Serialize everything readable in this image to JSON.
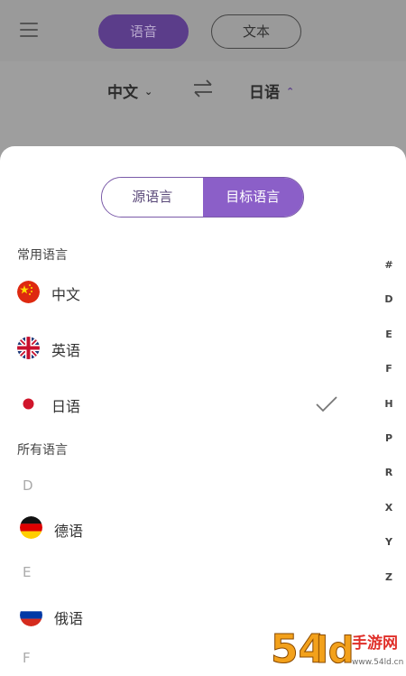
{
  "header": {
    "mode_voice": "语音",
    "mode_text": "文本"
  },
  "langbar": {
    "source": "中文",
    "target": "日语"
  },
  "sheet": {
    "tab_source": "源语言",
    "tab_target": "目标语言",
    "common_title": "常用语言",
    "common": [
      {
        "label": "中文",
        "flag": "china-flag-icon"
      },
      {
        "label": "英语",
        "flag": "uk-flag-icon"
      },
      {
        "label": "日语",
        "flag": "japan-flag-icon",
        "selected": true
      }
    ],
    "all_title": "所有语言",
    "groups": [
      {
        "letter": "D",
        "label": "德语",
        "flag": "germany-flag-icon"
      },
      {
        "letter": "E",
        "label": "俄语",
        "flag": "russia-flag-icon"
      },
      {
        "letter": "F"
      }
    ],
    "index": [
      "#",
      "D",
      "E",
      "F",
      "H",
      "P",
      "R",
      "X",
      "Y",
      "Z"
    ]
  },
  "watermark": {
    "text": "54ld手游网",
    "url": "www.54ld.cn"
  },
  "colors": {
    "accent": "#8b5fc8",
    "accent_dark": "#5b3d8a"
  }
}
